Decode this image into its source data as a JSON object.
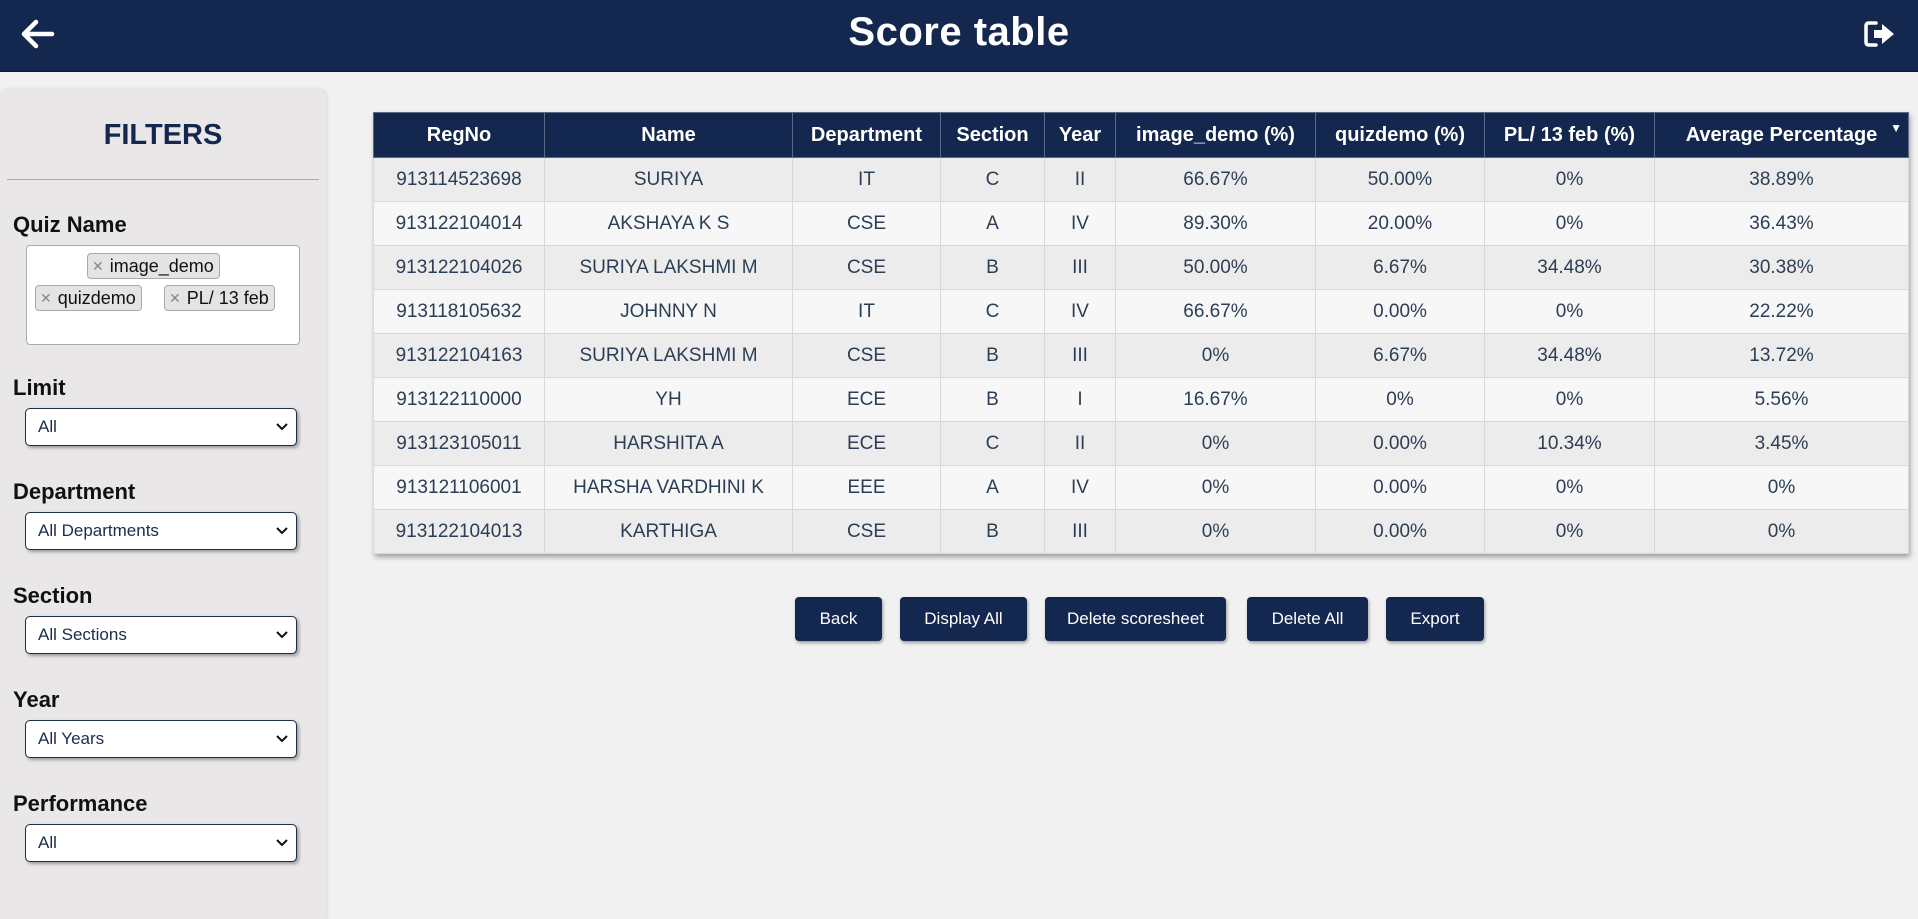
{
  "header": {
    "title": "Score table",
    "back_icon": "arrow-left-icon",
    "logout_icon": "sign-out-icon",
    "bg_color": "#13274f"
  },
  "sidebar": {
    "title": "FILTERS",
    "quiz_name": {
      "label": "Quiz Name",
      "tags": [
        "image_demo",
        "quizdemo",
        "PL/ 13 feb"
      ]
    },
    "limit": {
      "label": "Limit",
      "value": "All"
    },
    "department": {
      "label": "Department",
      "value": "All Departments"
    },
    "section": {
      "label": "Section",
      "value": "All Sections"
    },
    "year": {
      "label": "Year",
      "value": "All Years"
    },
    "performance": {
      "label": "Performance",
      "value": "All"
    }
  },
  "table": {
    "columns": [
      "RegNo",
      "Name",
      "Department",
      "Section",
      "Year",
      "image_demo (%)",
      "quizdemo (%)",
      "PL/ 13 feb (%)",
      "Average Percentage"
    ],
    "sort_indicator": "▼",
    "rows": [
      [
        "913114523698",
        "SURIYA",
        "IT",
        "C",
        "II",
        "66.67%",
        "50.00%",
        "0%",
        "38.89%"
      ],
      [
        "913122104014",
        "AKSHAYA K S",
        "CSE",
        "A",
        "IV",
        "89.30%",
        "20.00%",
        "0%",
        "36.43%"
      ],
      [
        "913122104026",
        "SURIYA LAKSHMI M",
        "CSE",
        "B",
        "III",
        "50.00%",
        "6.67%",
        "34.48%",
        "30.38%"
      ],
      [
        "913118105632",
        "JOHNNY N",
        "IT",
        "C",
        "IV",
        "66.67%",
        "0.00%",
        "0%",
        "22.22%"
      ],
      [
        "913122104163",
        "SURIYA LAKSHMI M",
        "CSE",
        "B",
        "III",
        "0%",
        "6.67%",
        "34.48%",
        "13.72%"
      ],
      [
        "913122110000",
        "YH",
        "ECE",
        "B",
        "I",
        "16.67%",
        "0%",
        "0%",
        "5.56%"
      ],
      [
        "913123105011",
        "HARSHITA A",
        "ECE",
        "C",
        "II",
        "0%",
        "0.00%",
        "10.34%",
        "3.45%"
      ],
      [
        "913121106001",
        "HARSHA VARDHINI K",
        "EEE",
        "A",
        "IV",
        "0%",
        "0.00%",
        "0%",
        "0%"
      ],
      [
        "913122104013",
        "KARTHIGA",
        "CSE",
        "B",
        "III",
        "0%",
        "0.00%",
        "0%",
        "0%"
      ]
    ]
  },
  "actions": {
    "back": "Back",
    "display_all": "Display All",
    "delete_scoresheet": "Delete scoresheet",
    "delete_all": "Delete All",
    "export": "Export"
  }
}
